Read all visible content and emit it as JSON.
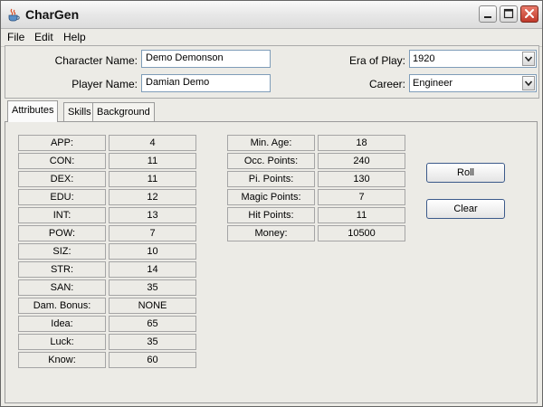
{
  "window": {
    "title": "CharGen"
  },
  "menu": {
    "file": "File",
    "edit": "Edit",
    "help": "Help"
  },
  "header": {
    "character_name_label": "Character Name:",
    "character_name_value": "Demo Demonson",
    "player_name_label": "Player Name:",
    "player_name_value": "Damian Demo",
    "era_label": "Era of Play:",
    "era_value": "1920",
    "career_label": "Career:",
    "career_value": "Engineer"
  },
  "tabs": [
    "Attributes",
    "Skills",
    "Background"
  ],
  "attributes": [
    {
      "label": "APP:",
      "value": "4"
    },
    {
      "label": "CON:",
      "value": "11"
    },
    {
      "label": "DEX:",
      "value": "11"
    },
    {
      "label": "EDU:",
      "value": "12"
    },
    {
      "label": "INT:",
      "value": "13"
    },
    {
      "label": "POW:",
      "value": "7"
    },
    {
      "label": "SIZ:",
      "value": "10"
    },
    {
      "label": "STR:",
      "value": "14"
    },
    {
      "label": "SAN:",
      "value": "35"
    },
    {
      "label": "Dam. Bonus:",
      "value": "NONE"
    },
    {
      "label": "Idea:",
      "value": "65"
    },
    {
      "label": "Luck:",
      "value": "35"
    },
    {
      "label": "Know:",
      "value": "60"
    }
  ],
  "derived": [
    {
      "label": "Min. Age:",
      "value": "18"
    },
    {
      "label": "Occ. Points:",
      "value": "240"
    },
    {
      "label": "Pi. Points:",
      "value": "130"
    },
    {
      "label": "Magic Points:",
      "value": "7"
    },
    {
      "label": "Hit Points:",
      "value": "11"
    },
    {
      "label": "Money:",
      "value": "10500"
    }
  ],
  "buttons": {
    "roll": "Roll",
    "clear": "Clear"
  }
}
